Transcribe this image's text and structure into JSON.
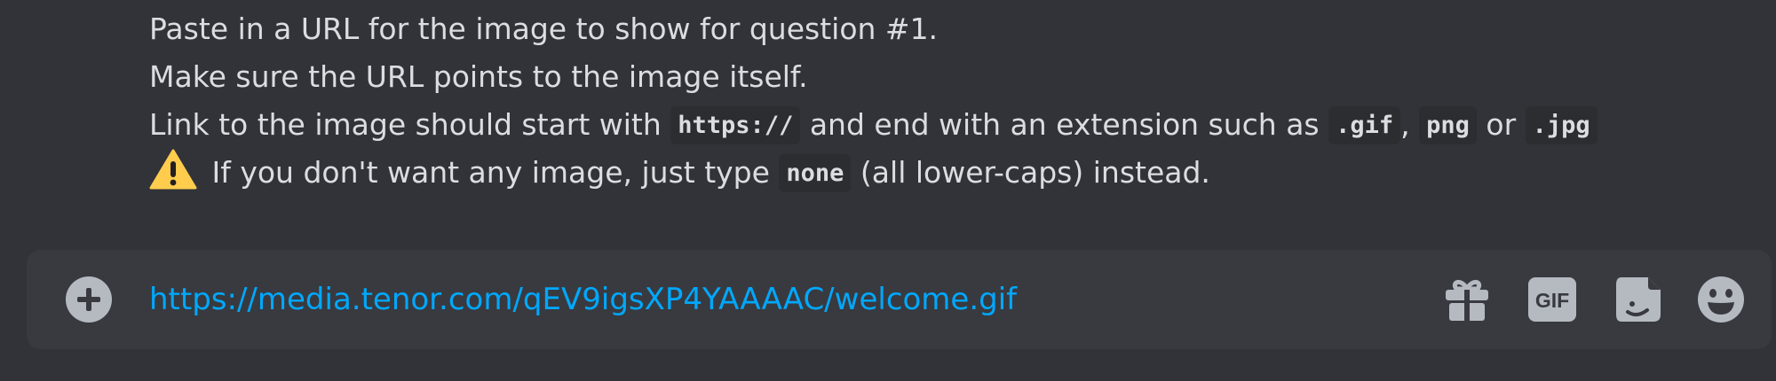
{
  "message": {
    "line1": "Paste in a URL for the image to show for question #1.",
    "line2": "Make sure the URL points to the image itself.",
    "line3": {
      "pre": "Link to the image should start with ",
      "code1": "https://",
      "mid1": " and end with an extension such as ",
      "code2": ".gif",
      "sep1": ", ",
      "code3": "png",
      "sep2": " or ",
      "code4": ".jpg"
    },
    "line4": {
      "icon": "warning-icon",
      "pre": " If you don't want any image, just type ",
      "code": "none",
      "post": " (all lower-caps) instead."
    }
  },
  "composer": {
    "input_value": "https://media.tenor.com/qEV9igsXP4YAAAAC/welcome.gif",
    "gif_label": "GIF",
    "icons": {
      "attach": "plus-circle-icon",
      "gift": "gift-icon",
      "gif": "gif-icon",
      "sticker": "sticker-icon",
      "emoji": "emoji-icon"
    }
  },
  "colors": {
    "background": "#313338",
    "composer_bg": "#383a40",
    "text": "#dbdee1",
    "link": "#00a8fc",
    "icon": "#b5bac1",
    "code_bg": "#2b2d31",
    "warning": "#ffcc4d"
  }
}
